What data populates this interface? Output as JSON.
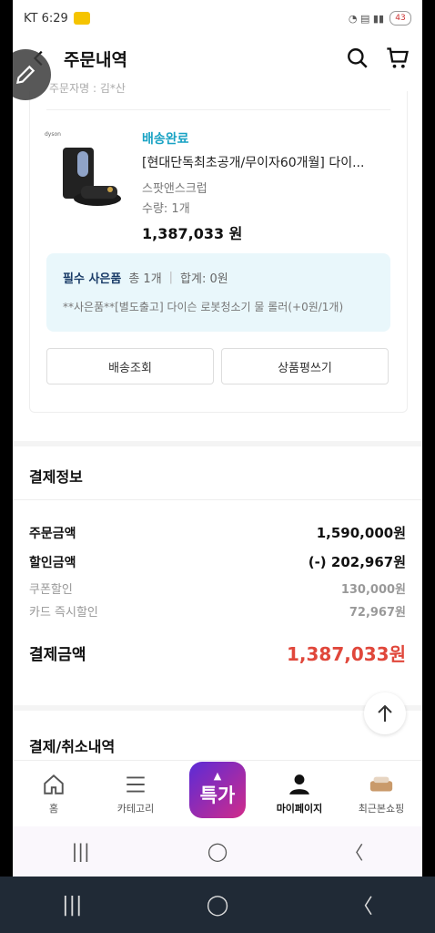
{
  "status_bar": {
    "carrier_time": "KT 6:29",
    "battery": "43"
  },
  "header": {
    "title": "주문내역"
  },
  "cut_text": "주문자명 : 김*산",
  "order_item": {
    "status": "배송완료",
    "product_name": "[현대단독최초공개/무이자60개월] 다이...",
    "option": "스팟앤스크럽",
    "quantity": "수량: 1개",
    "price": "1,387,033 원",
    "brand_label": "dyson"
  },
  "gift": {
    "label": "필수 사은품",
    "count": "총 1개",
    "sep": "|",
    "total": "합계: 0원",
    "desc": "**사은품**[별도출고] 다이슨 로봇청소기 물 롤러(+0원/1개)"
  },
  "buttons": {
    "track": "배송조회",
    "review": "상품평쓰기"
  },
  "payment": {
    "section_title": "결제정보",
    "rows": [
      {
        "label": "주문금액",
        "value": "1,590,000원"
      },
      {
        "label": "할인금액",
        "value": "(-) 202,967원"
      },
      {
        "label": "쿠폰할인",
        "value": "130,000원"
      },
      {
        "label": "카드 즉시할인",
        "value": "72,967원"
      },
      {
        "label": "결제금액",
        "value": "1,387,033원"
      }
    ],
    "accent_color": "#e0473b"
  },
  "cancel_section_title": "결제/취소내역",
  "tabbar": {
    "items": [
      {
        "label": "홈",
        "icon": "home-icon"
      },
      {
        "label": "카테고리",
        "icon": "menu-icon"
      },
      {
        "label": "특가",
        "icon": "special-deal-icon"
      },
      {
        "label": "마이페이지",
        "icon": "person-icon"
      },
      {
        "label": "최근본쇼핑",
        "icon": "recent-item-thumbnail"
      }
    ]
  },
  "colors": {
    "status_teal": "#1aa3c4",
    "gift_bg": "#e9f7fb"
  }
}
